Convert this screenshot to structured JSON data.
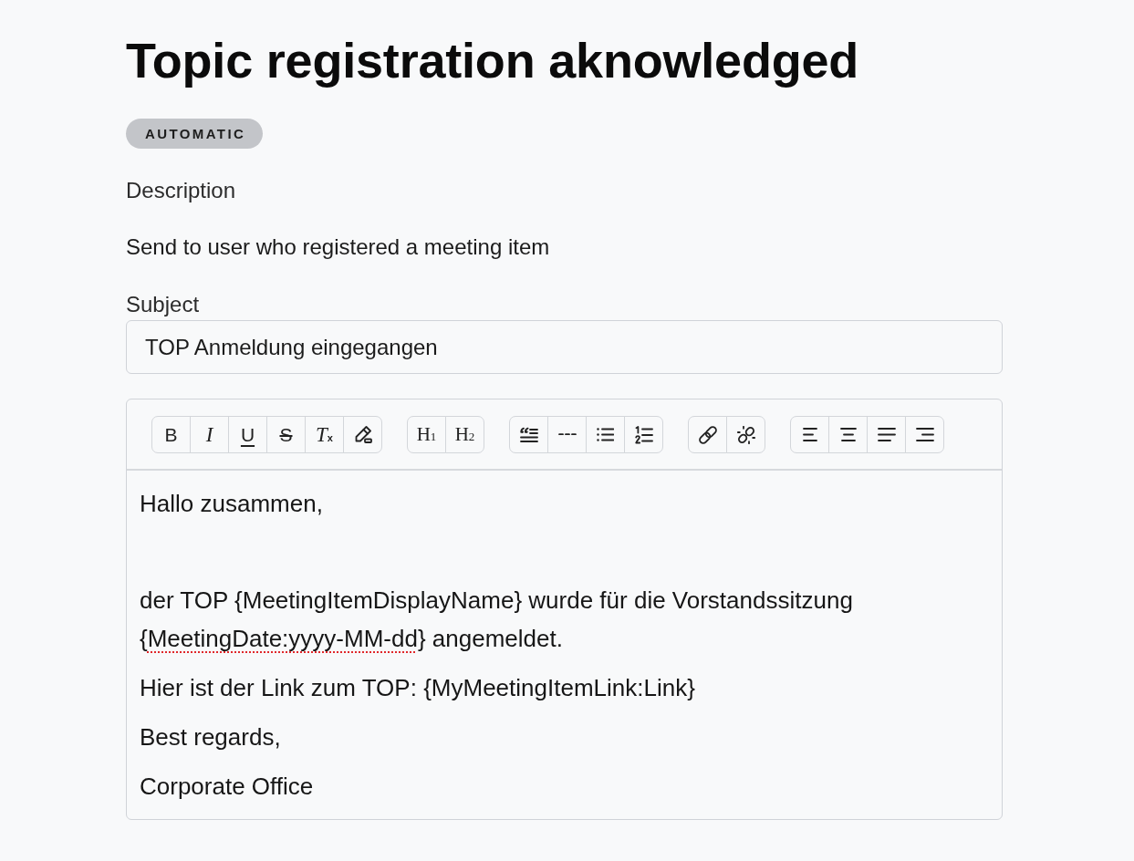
{
  "title": "Topic registration aknowledged",
  "badge": "AUTOMATIC",
  "description": {
    "label": "Description",
    "text": "Send to user who registered a meeting item"
  },
  "subject": {
    "label": "Subject",
    "value": "TOP Anmeldung eingegangen"
  },
  "editor": {
    "toolbar": [
      [
        {
          "kind": "bold",
          "label": "B"
        },
        {
          "kind": "italic",
          "label": "I"
        },
        {
          "kind": "underline",
          "label": "U"
        },
        {
          "kind": "strike",
          "label": "S"
        },
        {
          "kind": "clear-format",
          "label": "*T*$_{x}$"
        },
        {
          "kind": "highlight"
        }
      ],
      [
        {
          "kind": "heading",
          "label": "H$_{1}$"
        },
        {
          "kind": "heading",
          "label": "H$_{2}$"
        }
      ],
      [
        {
          "kind": "blockquote"
        },
        {
          "kind": "rule"
        },
        {
          "kind": "bullet-list"
        },
        {
          "kind": "ordered-list"
        }
      ],
      [
        {
          "kind": "link"
        },
        {
          "kind": "unlink"
        }
      ],
      [
        {
          "kind": "align-left"
        },
        {
          "kind": "align-center"
        },
        {
          "kind": "align-justify"
        },
        {
          "kind": "align-right"
        }
      ]
    ],
    "paragraphs": [
      {
        "kind": "text",
        "runs": [
          {
            "text": "Hallo zusammen,",
            "misspelled": false
          }
        ]
      },
      {
        "kind": "blank"
      },
      {
        "kind": "text",
        "runs": [
          {
            "text": "der TOP {MeetingItemDisplayName} wurde für die Vorstandssitzung {",
            "misspelled": false
          },
          {
            "text": "MeetingDate:yyyy-MM-dd",
            "misspelled": true
          },
          {
            "text": "} angemeldet.",
            "misspelled": false
          }
        ]
      },
      {
        "kind": "text",
        "runs": [
          {
            "text": "Hier ist der Link zum TOP: {MyMeetingItemLink:Link}",
            "misspelled": false
          }
        ]
      },
      {
        "kind": "text",
        "runs": [
          {
            "text": "Best regards,",
            "misspelled": false
          }
        ]
      },
      {
        "kind": "text",
        "runs": [
          {
            "text": "Corporate Office",
            "misspelled": false
          }
        ]
      }
    ]
  }
}
